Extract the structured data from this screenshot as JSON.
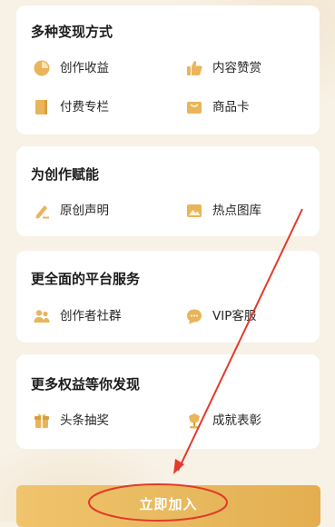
{
  "sections": [
    {
      "title": "多种变现方式",
      "items": [
        {
          "label": "创作收益",
          "icon": "pie-chart-icon"
        },
        {
          "label": "内容赞赏",
          "icon": "thumbs-up-icon"
        },
        {
          "label": "付费专栏",
          "icon": "book-icon"
        },
        {
          "label": "商品卡",
          "icon": "shop-card-icon"
        }
      ]
    },
    {
      "title": "为创作赋能",
      "items": [
        {
          "label": "原创声明",
          "icon": "pen-icon"
        },
        {
          "label": "热点图库",
          "icon": "image-icon"
        }
      ]
    },
    {
      "title": "更全面的平台服务",
      "items": [
        {
          "label": "创作者社群",
          "icon": "people-icon"
        },
        {
          "label": "VIP客服",
          "icon": "chat-bubble-icon"
        }
      ]
    },
    {
      "title": "更多权益等你发现",
      "items": [
        {
          "label": "头条抽奖",
          "icon": "gift-icon"
        },
        {
          "label": "成就表彰",
          "icon": "trophy-icon"
        }
      ]
    }
  ],
  "join_button": {
    "label": "立即加入"
  },
  "colors": {
    "accent": "#e9b55a",
    "icon_gold": "#eab45a",
    "annotation_red": "#e23a2c",
    "background": "#f8f1e6"
  }
}
